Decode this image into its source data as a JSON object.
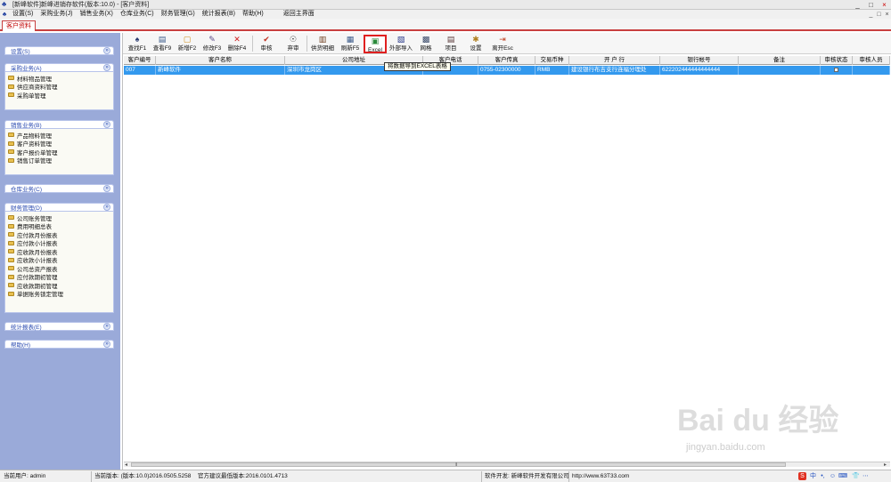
{
  "window": {
    "title": "[新峰软件]新峰进销存软件(版本:10.0) - [客户资料]",
    "controls": [
      "_",
      "□",
      "×"
    ]
  },
  "menu": {
    "items": [
      "设置(S)",
      "采购业务(J)",
      "销售业务(X)",
      "仓库业务(C)",
      "财务管理(G)",
      "统计报表(B)",
      "帮助(H)",
      "返回主界面"
    ],
    "controls": [
      "_",
      "□",
      "×"
    ]
  },
  "tab": {
    "label": "客户资料"
  },
  "sidebar": {
    "panels": [
      {
        "title": "设置(S)",
        "items": []
      },
      {
        "title": "采购业务(A)",
        "items": [
          "材料物品管理",
          "供应商资料管理",
          "采购单管理"
        ]
      },
      {
        "title": "销售业务(B)",
        "items": [
          "产品物料管理",
          "客户资料管理",
          "客户报价单管理",
          "销售订单管理"
        ]
      },
      {
        "title": "仓库业务(C)",
        "items": []
      },
      {
        "title": "财务管理(D)",
        "items": [
          "公司账务管理",
          "费用明细总表",
          "应付款月份报表",
          "应付款小计报表",
          "应收款月份报表",
          "应收款小计报表",
          "公司总资产报表",
          "应付款期初管理",
          "应收款期初管理",
          "单据账务锁定管理"
        ]
      },
      {
        "title": "统计报表(E)",
        "items": []
      },
      {
        "title": "帮助(H)",
        "items": []
      }
    ],
    "chevron": "»"
  },
  "toolbar": {
    "buttons": [
      {
        "label": "查找F1",
        "icon": "binoculars-icon",
        "glyph": "♠"
      },
      {
        "label": "查看F9",
        "icon": "view-icon",
        "glyph": "▤"
      },
      {
        "label": "新增F2",
        "icon": "new-icon",
        "glyph": "▢"
      },
      {
        "label": "修改F3",
        "icon": "edit-icon",
        "glyph": "✎"
      },
      {
        "label": "删除F4",
        "icon": "delete-icon",
        "glyph": "✕"
      },
      {
        "label": "审核",
        "icon": "check-icon",
        "glyph": "✔"
      },
      {
        "label": "弃审",
        "icon": "unapprove-icon",
        "glyph": "☉"
      },
      {
        "label": "供货明细",
        "icon": "detail-icon",
        "glyph": "▥"
      },
      {
        "label": "刷新F5",
        "icon": "refresh-icon",
        "glyph": "▦"
      },
      {
        "label": "Excel",
        "icon": "excel-icon",
        "glyph": "▣"
      },
      {
        "label": "外部导入",
        "icon": "import-icon",
        "glyph": "▧"
      },
      {
        "label": "网格",
        "icon": "grid-icon",
        "glyph": "▩"
      },
      {
        "label": "项目",
        "icon": "project-icon",
        "glyph": "▤"
      },
      {
        "label": "设置",
        "icon": "settings-icon",
        "glyph": "✱"
      },
      {
        "label": "离开Esc",
        "icon": "exit-icon",
        "glyph": "⇥"
      }
    ],
    "tooltip": "将数据导到EXCEL表格"
  },
  "table": {
    "columns": [
      "客户编号",
      "客户名称",
      "公司地址",
      "客户电话",
      "客户传真",
      "交易币种",
      "开 户 行",
      "银行帐号",
      "备注",
      "审核状态",
      "审核人员"
    ],
    "rows": [
      [
        "007",
        "新峰软件",
        "深圳市龙岗区",
        "…0000",
        "0755-02300000",
        "RMB",
        "建设银行布吉支行连福分理处",
        "622202444444444444",
        "",
        "",
        ""
      ]
    ],
    "scroll_arrows": [
      "◂",
      "▸"
    ],
    "scroll_grip": "⦀"
  },
  "status": {
    "user": "当前用户: admin",
    "version": "当前版本: (版本:10.0)2016.0505.5258",
    "latest": "官方建议最低版本:2016.0101.4713",
    "developer": "软件开发: 新峰软件开发有限公司",
    "website": "http://www.63T33.com",
    "tray": [
      "S",
      "中",
      "•,",
      "☺",
      "⌨",
      "👕",
      "⋯"
    ]
  },
  "watermark": {
    "text": "Bai du 经验",
    "sub": "jingyan.baidu.com"
  },
  "colors": {
    "sidebar_bg": "#9aaad9",
    "panel_title": "#2a4ab0",
    "row_selected": "#3399ee",
    "tab_accent": "#c84040",
    "excel_highlight": "#e02020"
  }
}
